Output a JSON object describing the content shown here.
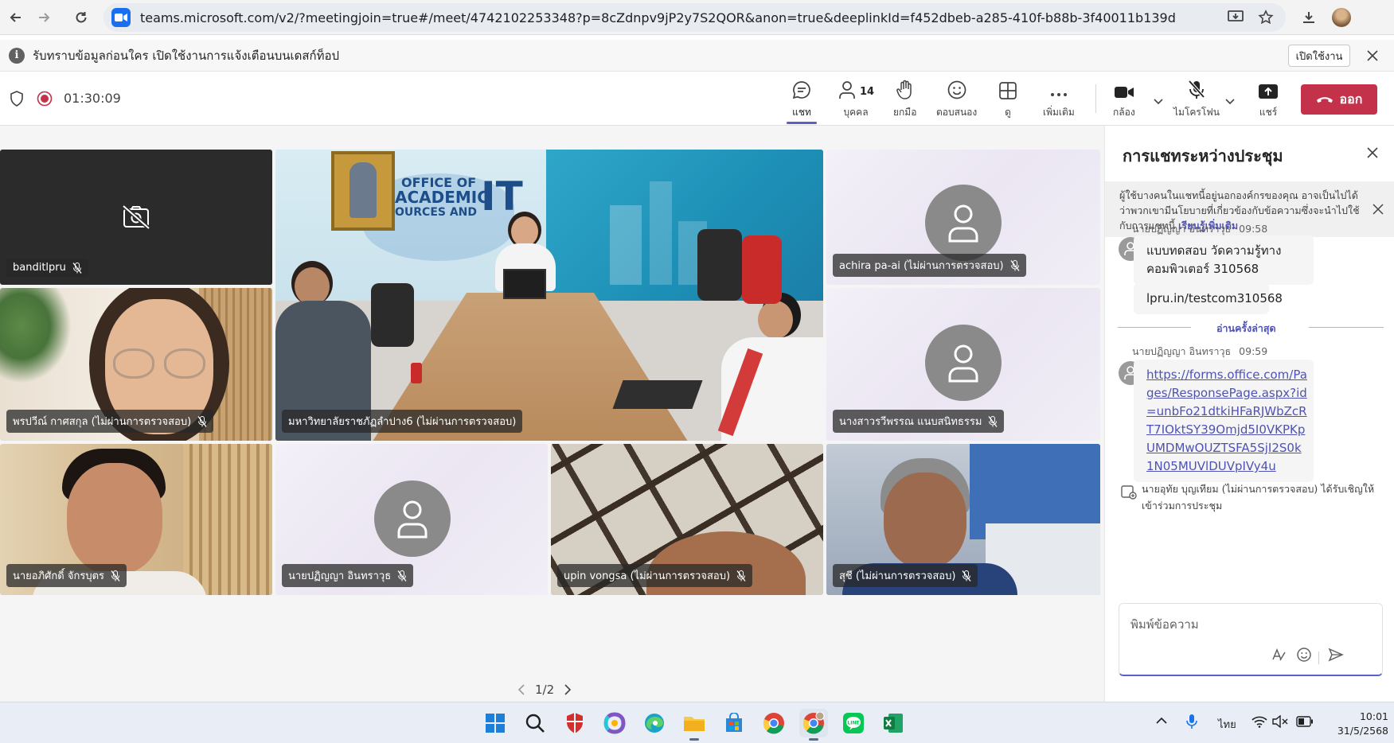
{
  "browser": {
    "url": "teams.microsoft.com/v2/?meetingjoin=true#/meet/4742102253348?p=8cZdnpv9jP2y7S2QOR&anon=true&deeplinkId=f452dbeb-a285-410f-b88b-3f40011b139d"
  },
  "notification": {
    "text": "รับทราบข้อมูลก่อนใคร เปิดใช้งานการแจ้งเตือนบนเดสก์ท็อป",
    "enable_label": "เปิดใช้งาน"
  },
  "toolbar": {
    "timer": "01:30:09",
    "chat_label": "แชท",
    "people_label": "บุคคล",
    "people_count": "14",
    "raise_label": "ยกมือ",
    "react_label": "ตอบสนอง",
    "view_label": "ดู",
    "more_label": "เพิ่มเติม",
    "camera_label": "กล้อง",
    "mic_label": "ไมโครโฟน",
    "share_label": "แชร์",
    "leave_label": "ออก"
  },
  "participants": [
    {
      "name": "banditlpru"
    },
    {
      "name": "มหาวิทยาลัยราชภัฏลำปาง6 (ไม่ผ่านการตรวจสอบ)"
    },
    {
      "name": "achira pa-ai (ไม่ผ่านการตรวจสอบ)"
    },
    {
      "name": "พรปวีณ์ กาศสกุล (ไม่ผ่านการตรวจสอบ)"
    },
    {
      "name": "นางสาวรวีพรรณ แนบสนิทธรรม"
    },
    {
      "name": "นายอภิศักดิ์ จักรบุตร"
    },
    {
      "name": "นายปฏิญญา อินทราวุธ"
    },
    {
      "name": "upin vongsa (ไม่ผ่านการตรวจสอบ)"
    },
    {
      "name": "สุชี (ไม่ผ่านการตรวจสอบ)"
    }
  ],
  "video_tile": {
    "sign_line1": "OFFICE OF",
    "sign_line2": "ACADEMIC",
    "sign_line3": "OURCES AND",
    "sign_it": "IT"
  },
  "pager": {
    "text": "1/2"
  },
  "chat": {
    "title": "การแชทระหว่างประชุม",
    "banner_text": "ผู้ใช้บางคนในแชทนี้อยู่นอกองค์กรของคุณ อาจเป็นไปได้ว่าพวกเขามีนโยบายที่เกี่ยวข้องกับข้อความซึ่งจะนำไปใช้กับการแชทนี้",
    "banner_link": "เรียนรู้เพิ่มเติม",
    "msg1_sender": "นายปฏิญญา อินทราวุธ",
    "msg1_time": "09:58",
    "msg1_text": "แบบทดสอบ วัดความรู้ทางคอมพิวเตอร์ 310568",
    "msg1b_text": "lpru.in/testcom310568",
    "divider_text": "อ่านครั้งล่าสุด",
    "msg2_sender": "นายปฏิญญา อินทราวุธ",
    "msg2_time": "09:59",
    "msg2_link": "https://forms.office.com/Pages/ResponsePage.aspx?id=unbFo21dtkiHFaRJWbZcRT7IOktSY39Omjd5I0VKPKpUMDMwOUZTSFA5SjI2S0k1N05MUVlDUVpIVy4u",
    "event_text": "นายอุทัย บุญเทียม (ไม่ผ่านการตรวจสอบ) ได้รับเชิญให้เข้าร่วมการประชุม",
    "compose_placeholder": "พิมพ์ข้อความ"
  },
  "taskbar": {
    "lang": "ไทย",
    "time": "10:01",
    "date": "31/5/2568"
  },
  "colors": {
    "accent": "#5b5fc7",
    "leave": "#c4314b",
    "edge_blue": "#1a6ef0"
  }
}
